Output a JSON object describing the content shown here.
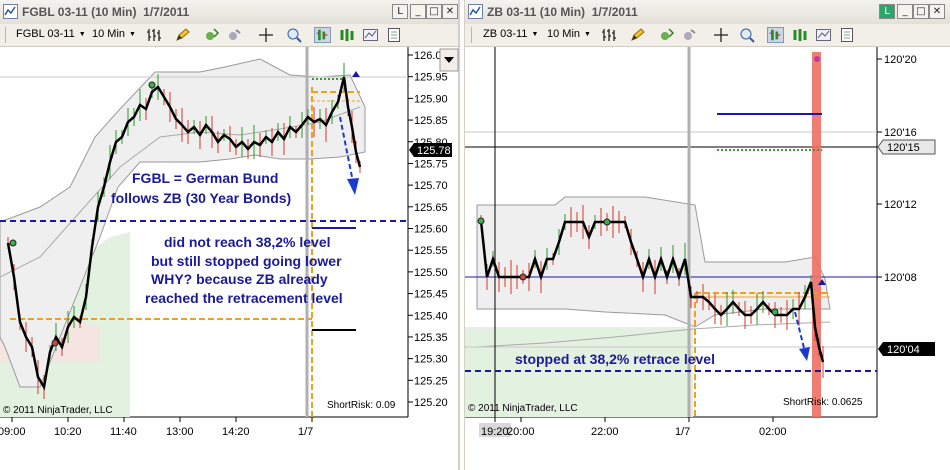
{
  "left": {
    "title": "FGBL 03-11 (10 Min)  1/7/2011",
    "instrument": "FGBL 03-11",
    "interval": "10 Min",
    "price_ticks": [
      "126.0",
      "125.95",
      "125.90",
      "125.85",
      "125.80",
      "125.75",
      "125.70",
      "125.65",
      "125.60",
      "125.55",
      "125.50",
      "125.45",
      "125.40",
      "125.35",
      "125.30",
      "125.25",
      "125.20"
    ],
    "current_price": "125.78",
    "time_ticks": [
      "09:00",
      "10:20",
      "11:40",
      "13:00",
      "14:20",
      "1/7"
    ],
    "annotation_lines": [
      "FGBL = German Bund",
      "follows ZB (30 Year Bonds)",
      "did not reach 38,2% level",
      "but still stopped going lower",
      "WHY? because ZB already",
      "reached the retracement level"
    ],
    "copyright": "© 2011 NinjaTrader, LLC",
    "short_risk": "ShortRisk: 0.09"
  },
  "right": {
    "title": "ZB 03-11 (10 Min)  1/7/2011",
    "instrument": "ZB 03-11",
    "interval": "10 Min",
    "price_ticks": [
      "120'20",
      "120'16",
      "120'12",
      "120'08"
    ],
    "level_label": "120'15",
    "current_price": "120'04",
    "time_ticks": [
      "19:20",
      "20:00",
      "22:00",
      "1/7",
      "02:00"
    ],
    "annotation": "stopped at 38,2% retrace level",
    "copyright": "© 2011 NinjaTrader, LLC",
    "short_risk": "ShortRisk: 0.0625"
  },
  "buttons": {
    "restore": "L",
    "minimize": "_",
    "maximize": "□",
    "close": "✕"
  },
  "colors": {
    "dashed_level": "#1a1aa0",
    "annotation": "#1a1a9a",
    "fib_orange": "#f0a020",
    "red_bar": "#ee6f62",
    "price_line": "#000000"
  },
  "icons": [
    "chart-style-icon",
    "drawing-tool-icon",
    "pan-icon",
    "crosshair-icon",
    "zoom-icon",
    "bar-type-icon",
    "properties-icon"
  ]
}
